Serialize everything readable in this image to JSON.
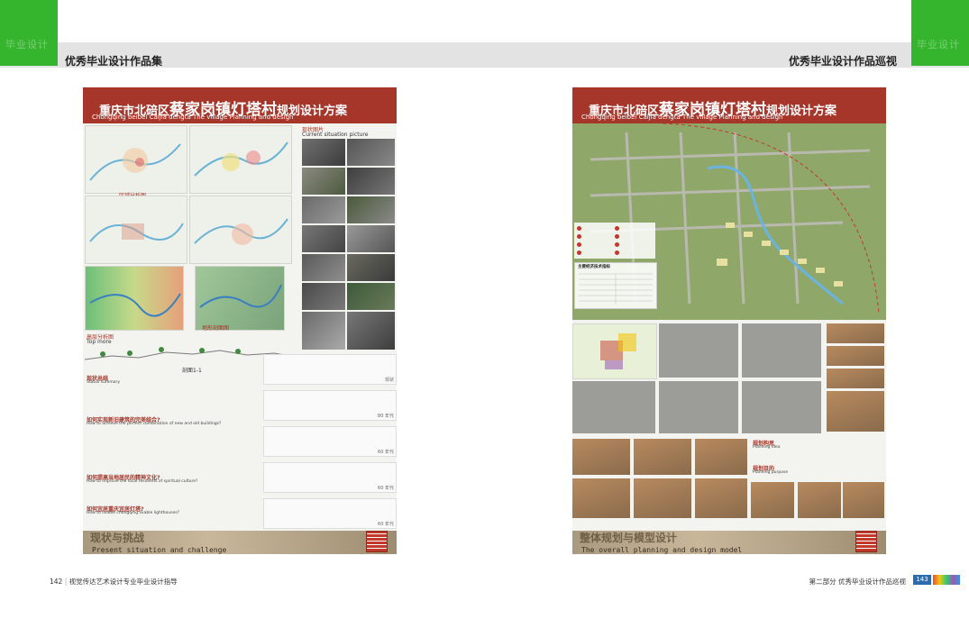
{
  "header": {
    "left_title": "优秀毕业设计作品集",
    "right_title": "优秀毕业设计作品巡视",
    "tab_mark": "毕业设计"
  },
  "left_poster": {
    "title_prefix": "重庆市北碚区",
    "title_big": "蔡家岗镇灯塔村",
    "title_suffix": "规划设计方案",
    "subtitle": "Chongqing beibei Caijia dengta The village Planning and design",
    "photos_label": "现状图片",
    "photos_label_en": "Current situation picture",
    "map_label_1": "区域分析图",
    "terrain_label": "高层分析图",
    "terrain_label_en": "Top more",
    "slope_label": "地形剖面图",
    "section_label": "剖面1-1",
    "status_title": "现状总结",
    "status_title_en": "Status summary",
    "q1": "如何实现新旧建筑的完美结合?",
    "q1_en": "How to achieve the perfect combination of new and old buildings?",
    "q2": "如何提高当地居民的精神文化?",
    "q2_en": "How to improve the local residents of spiritual culture?",
    "q3": "如何宜居重庆宜居灯塔?",
    "q3_en": "How to livable chongqing livable lighthouses?",
    "years": [
      "现状",
      "80 年代",
      "60 年代",
      "60 年代",
      "60 年代"
    ],
    "bottom_title": "现状与挑战",
    "bottom_sub": "Present situation and challenge"
  },
  "right_poster": {
    "title_prefix": "重庆市北碚区",
    "title_big": "蔡家岗镇灯塔村",
    "title_suffix": "规划设计方案",
    "subtitle": "Chongqing beibei Caijia dengta The village Planning and design",
    "table_title": "主要经济技术指标",
    "planning_title": "规划构思",
    "planning_title_en": "Planning idea",
    "goal_title": "规划目的",
    "goal_title_en": "Planning purpose",
    "bottom_title": "整体规划与模型设计",
    "bottom_sub": "The overall planning and design model"
  },
  "footer": {
    "left_page": "142",
    "left_text": "视觉传达艺术设计专业毕业设计指导",
    "right_text": "第二部分  优秀毕业设计作品巡视",
    "right_page": "143"
  },
  "colors": {
    "accent": "#a6352a",
    "brand_green": "#35b42e"
  }
}
